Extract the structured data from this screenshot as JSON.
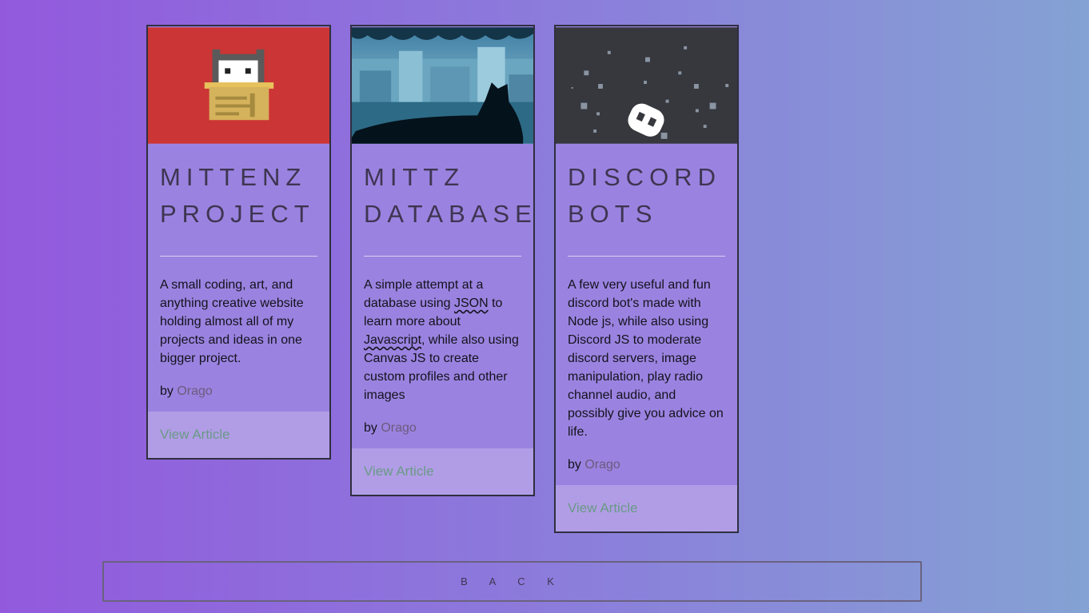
{
  "cards": [
    {
      "title": "MITTENZ\nPROJECT",
      "description": "A small coding, art, and anything creative website holding almost all of my projects and ideas in one bigger project.",
      "by_label": "by",
      "author": "Orago",
      "link": "View Article",
      "thumb_bg": "#cc3535",
      "thumb_icon": "cat-in-box-icon"
    },
    {
      "title": "MITTZ\nDATABASE",
      "description_parts": [
        "A simple attempt at a database using ",
        "JSON",
        " to learn more about ",
        "Javascript",
        ", while also using Canvas JS to create custom profiles and other images"
      ],
      "by_label": "by",
      "author": "Orago",
      "link": "View Article",
      "thumb_icon": "cat-rooftops-image"
    },
    {
      "title": "DISCORD\nBOTS",
      "description": "A few very useful and fun discord bot's made with Node js, while also using Discord JS to moderate discord servers, image manipulation, play radio channel audio, and possibly give you advice on life.",
      "by_label": "by",
      "author": "Orago",
      "link": "View Article",
      "thumb_bg": "#36383d",
      "thumb_icon": "discord-space-icon"
    }
  ],
  "back_label": "B A C K",
  "colors": {
    "accent_link": "#6a9a86",
    "author": "#6b5b7c"
  }
}
